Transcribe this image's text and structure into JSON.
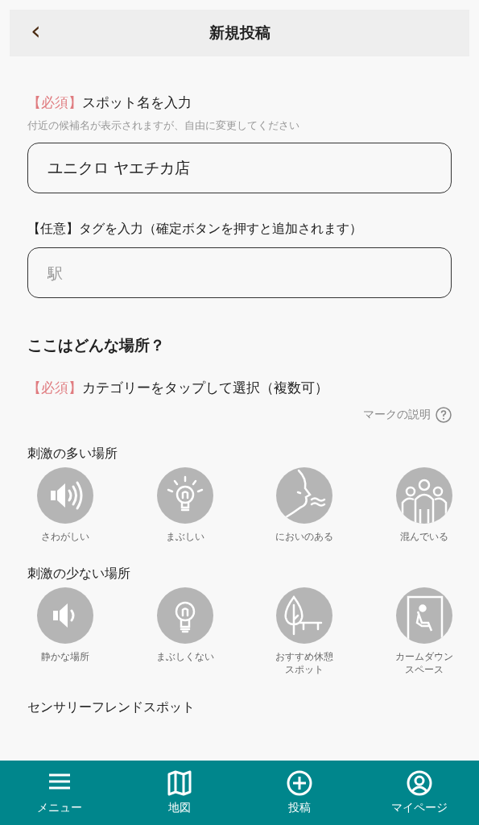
{
  "header": {
    "back": "‹",
    "title": "新規投稿"
  },
  "spot_name": {
    "required": "【必須】",
    "label": "スポット名を入力",
    "hint": "付近の候補名が表示されますが、自由に変更してください",
    "value": "ユニクロ ヤエチカ店"
  },
  "tags": {
    "label": "【任意】タグを入力（確定ボタンを押すと追加されます）",
    "placeholder": "駅"
  },
  "section_title": "ここはどんな場所？",
  "category_prompt": {
    "required": "【必須】",
    "label": "カテゴリーをタップして選択（複数可）"
  },
  "legend_link": "マークの説明",
  "groups": [
    {
      "title": "刺激の多い場所",
      "items": [
        {
          "kind": "loud",
          "label": "さわがしい",
          "selected": false
        },
        {
          "kind": "bright",
          "label": "まぶしい",
          "selected": false
        },
        {
          "kind": "smell",
          "label": "においのある",
          "selected": false
        },
        {
          "kind": "crowd",
          "label": "混んでいる",
          "selected": false
        }
      ]
    },
    {
      "title": "刺激の少ない場所",
      "items": [
        {
          "kind": "quiet",
          "label": "静かな場所",
          "selected": false
        },
        {
          "kind": "dim",
          "label": "まぶしくない",
          "selected": false
        },
        {
          "kind": "rest",
          "label": "おすすめ休憩スポット",
          "selected": false
        },
        {
          "kind": "calm",
          "label": "カームダウンスペース",
          "selected": false
        }
      ]
    },
    {
      "title": "センサリーフレンドスポット"
    }
  ],
  "nav": [
    {
      "kind": "menu",
      "label": "メニュー"
    },
    {
      "kind": "map",
      "label": "地図"
    },
    {
      "kind": "post",
      "label": "投稿"
    },
    {
      "kind": "mypage",
      "label": "マイページ"
    }
  ]
}
